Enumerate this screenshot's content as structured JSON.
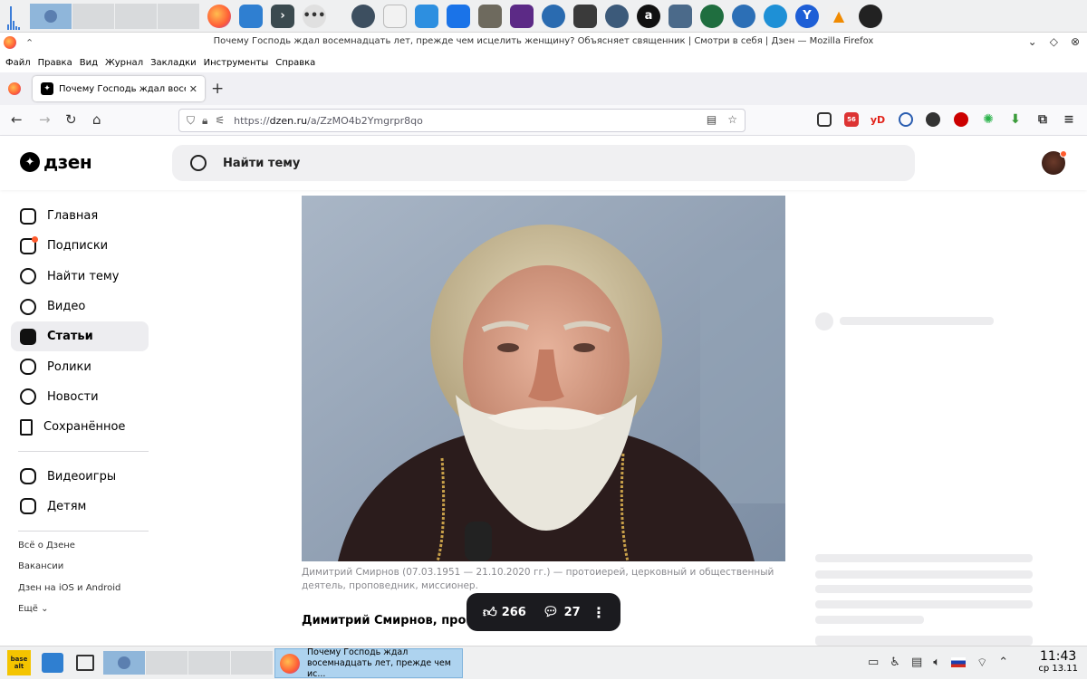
{
  "window": {
    "title": "Почему Господь ждал восемнадцать лет, прежде чем исцелить женщину? Объясняет священник | Смотри в себя | Дзен — Mozilla Firefox"
  },
  "menu": [
    "Файл",
    "Правка",
    "Вид",
    "Журнал",
    "Закладки",
    "Инструменты",
    "Справка"
  ],
  "tab": {
    "label": "Почему Господь ждал восем",
    "close": "✕"
  },
  "urlbar": {
    "prefix": "https://",
    "domain": "dzen.ru",
    "path": "/a/ZzMO4b2Ymgrpr8qo"
  },
  "extensions": {
    "ext1_badge": "56",
    "yandex_label": "yD"
  },
  "header": {
    "logo_text": "дзен",
    "search_label": "Найти тему"
  },
  "sidebar": {
    "items": [
      {
        "label": "Главная"
      },
      {
        "label": "Подписки"
      },
      {
        "label": "Найти тему"
      },
      {
        "label": "Видео"
      },
      {
        "label": "Статьи"
      },
      {
        "label": "Ролики"
      },
      {
        "label": "Новости"
      },
      {
        "label": "Сохранённое"
      }
    ],
    "secondary": [
      {
        "label": "Видеоигры"
      },
      {
        "label": "Детям"
      }
    ],
    "links": [
      "Всё о Дзене",
      "Вакансии",
      "Дзен на iOS и Android",
      "Ещё"
    ]
  },
  "article": {
    "caption": "Димитрий Смирнов (07.03.1951 — 21.10.2020 гг.) — протоиерей, церковный и общественный деятель, проповедник, миссионер.",
    "headline_start": "Димитрий Смирнов, про",
    "likes": "266",
    "comments": "27"
  },
  "taskbar": {
    "task_label": "Почему Господь ждал восемнадцать лет, прежде чем ис...",
    "time": "11:43",
    "date": "ср 13.11",
    "logo_text": "base alt"
  },
  "colors": {
    "accent": "#ff5b2d",
    "pill_bg": "#1b1b1f",
    "active_item_bg": "#ededf0"
  }
}
